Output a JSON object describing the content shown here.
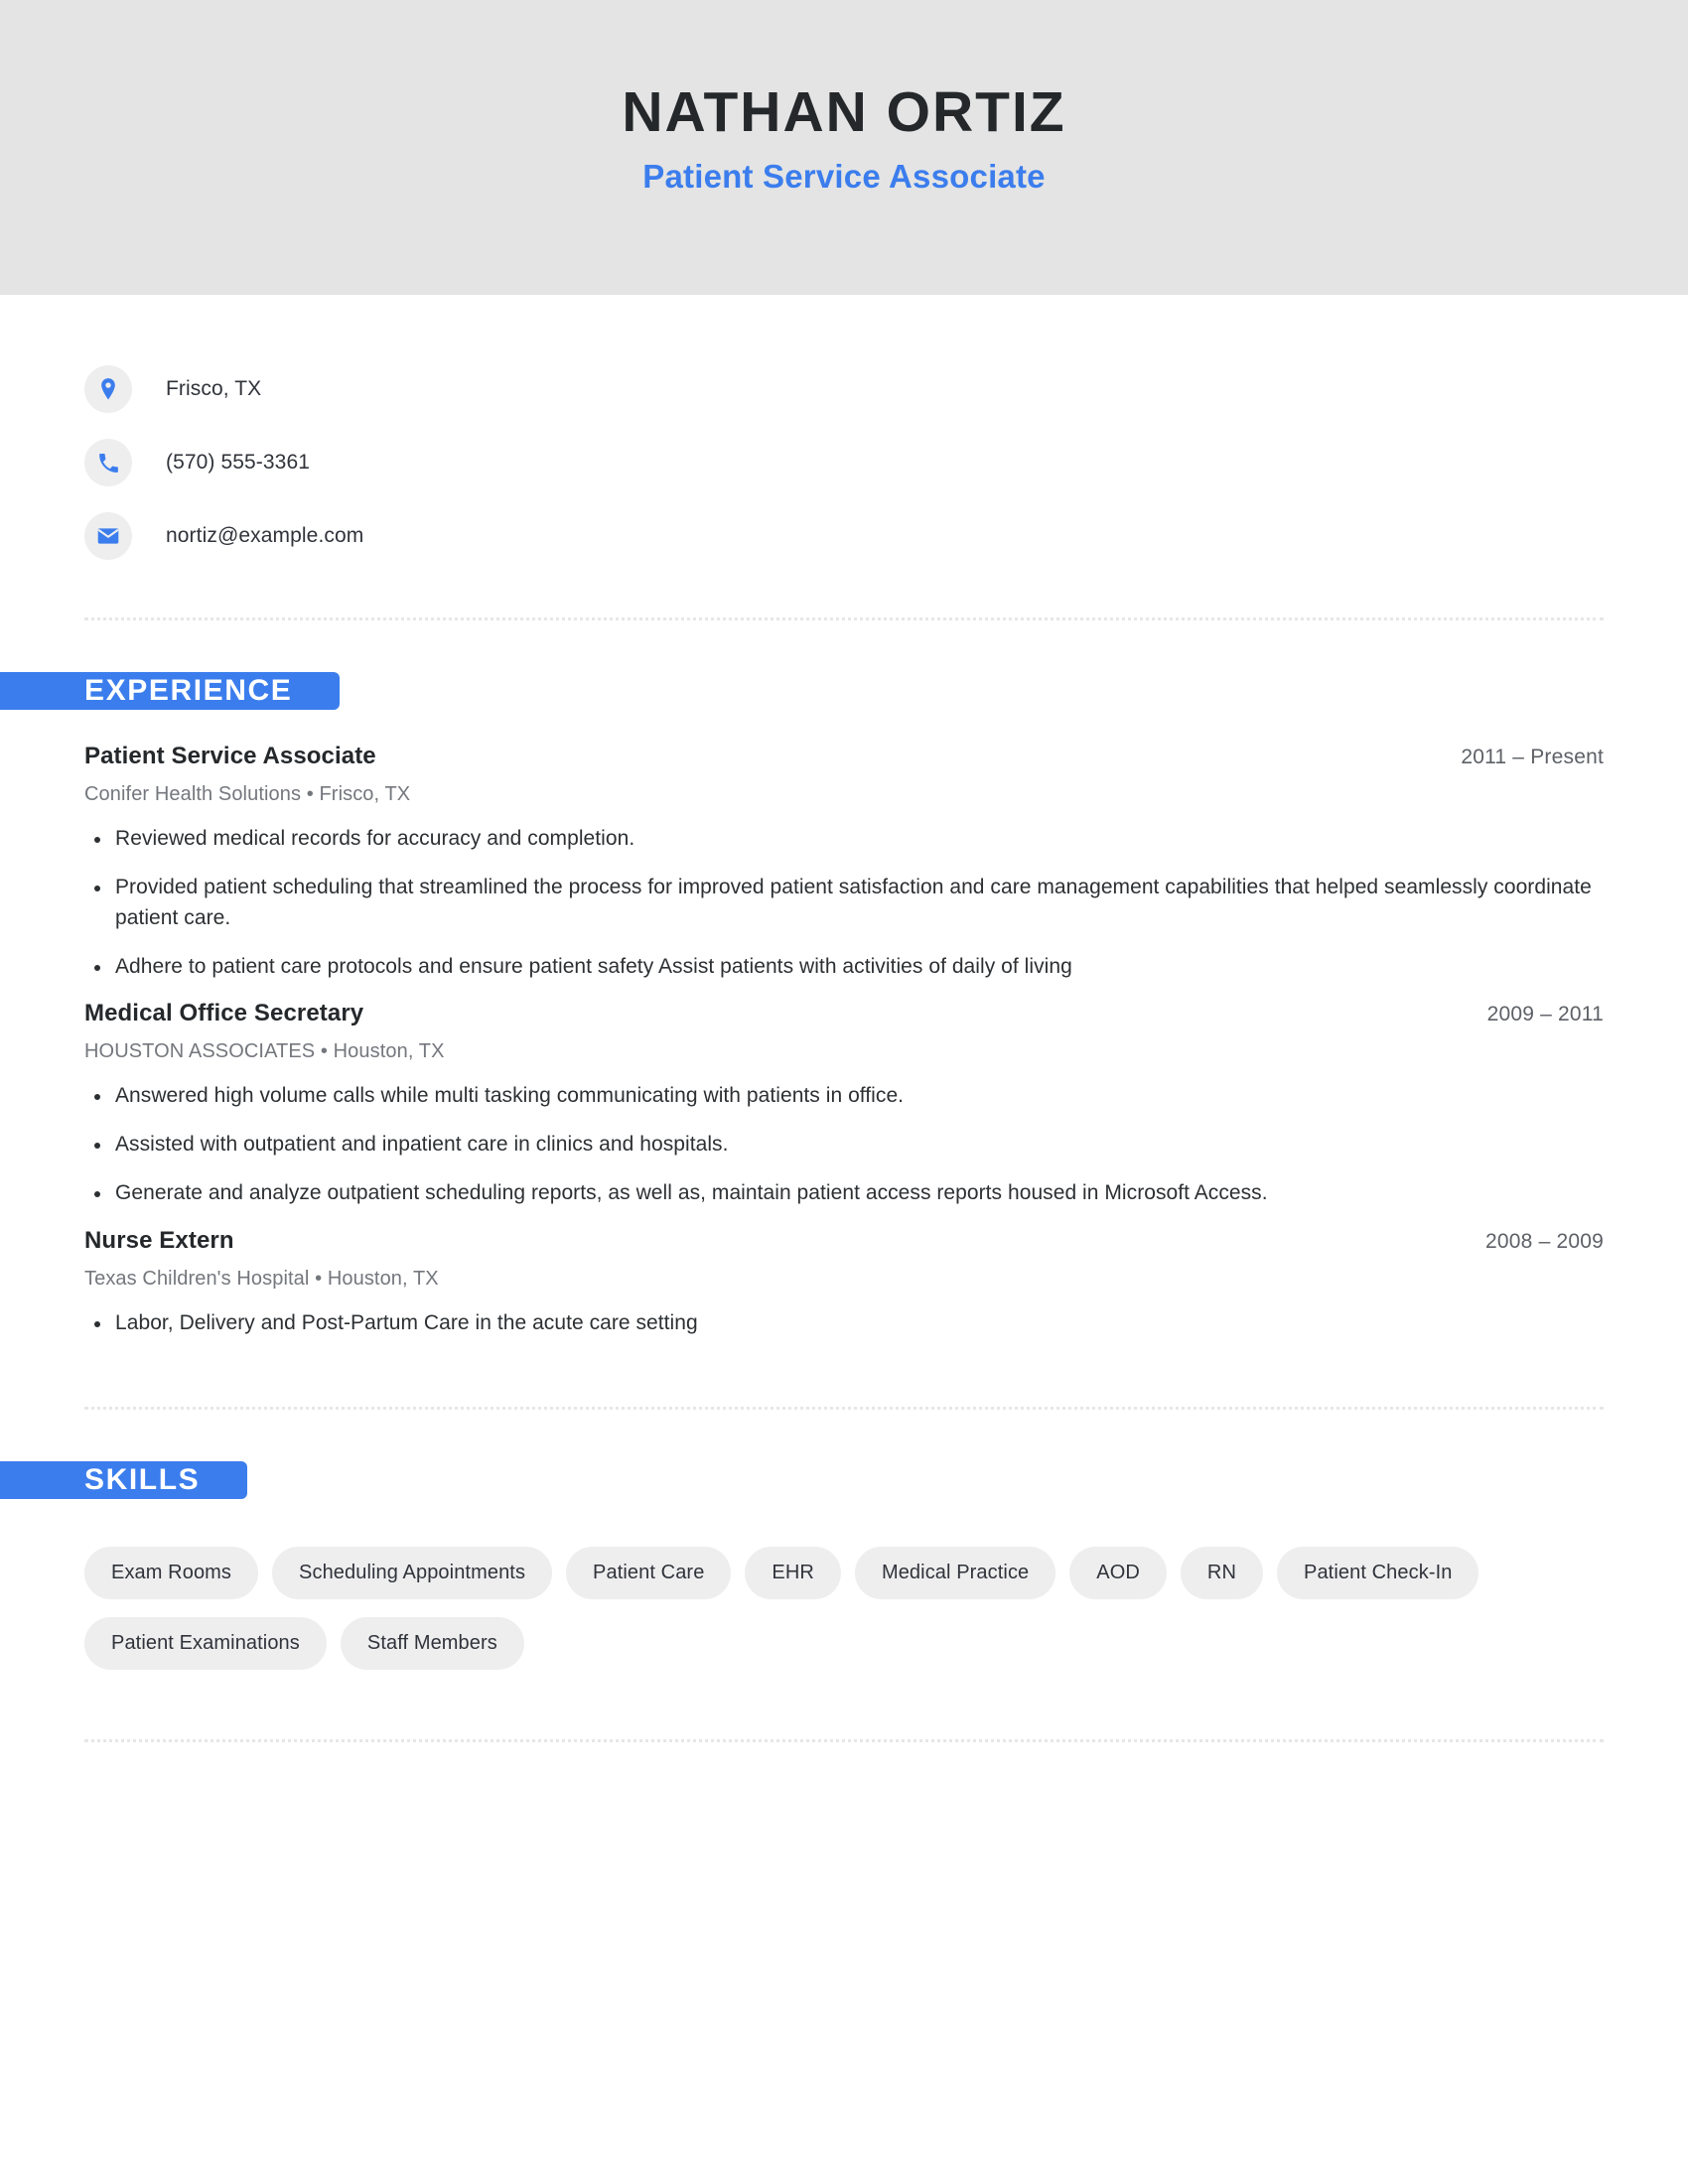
{
  "header": {
    "full_name": "NATHAN ORTIZ",
    "job_title": "Patient Service Associate",
    "band_color": "#e4e4e4",
    "accent_color": "#3b7ded"
  },
  "contact": {
    "items": [
      {
        "icon": "location-pin-icon",
        "label": "Frisco, TX"
      },
      {
        "icon": "phone-icon",
        "label": "(570) 555-3361"
      },
      {
        "icon": "email-icon",
        "label": "nortiz@example.com"
      }
    ]
  },
  "experience": {
    "heading": "EXPERIENCE",
    "entries": [
      {
        "title": "Patient Service Associate",
        "dates": "2011 – Present",
        "company": "Conifer Health Solutions  •  Frisco, TX",
        "bullets": [
          "Reviewed medical records for accuracy and completion.",
          "Provided patient scheduling that streamlined the process for improved patient satisfaction and care management capabilities that helped seamlessly coordinate patient care.",
          "Adhere to patient care protocols and ensure patient safety Assist patients with activities of daily of living"
        ]
      },
      {
        "title": "Medical Office Secretary",
        "dates": "2009 – 2011",
        "company": "HOUSTON ASSOCIATES  •  Houston, TX",
        "bullets": [
          "Answered high volume calls while multi tasking communicating with patients in office.",
          "Assisted with outpatient and inpatient care in clinics and hospitals.",
          "Generate and analyze outpatient scheduling reports, as well as, maintain patient access reports housed in Microsoft Access."
        ]
      },
      {
        "title": "Nurse Extern",
        "dates": "2008 – 2009",
        "company": "Texas Children's Hospital  •  Houston, TX",
        "bullets": [
          "Labor, Delivery and Post-Partum Care in the acute care setting"
        ]
      }
    ]
  },
  "skills": {
    "heading": "SKILLS",
    "items": [
      "Exam Rooms",
      "Scheduling Appointments",
      "Patient Care",
      "EHR",
      "Medical Practice",
      "AOD",
      "RN",
      "Patient Check-In",
      "Patient Examinations",
      "Staff Members"
    ]
  }
}
